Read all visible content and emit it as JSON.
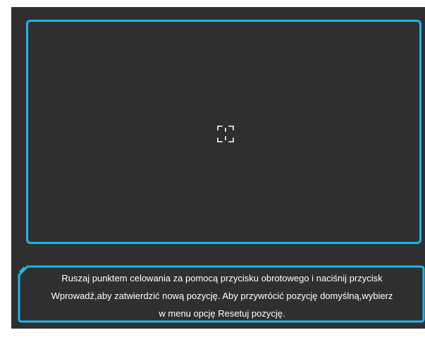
{
  "osd": {
    "crosshair_icon": "aim-point-crosshair",
    "message_lines": [
      "Ruszaj punktem celowania za pomocą przycisku obrotowego i naciśnij przycisk",
      "Wprowadź,aby zatwierdzić nową pozycję. Aby przywrócić pozycję domyślną,wybierz",
      "w menu opcję Resetuj pozycję."
    ]
  },
  "colors": {
    "background": "#2f2f2f",
    "accent": "#1fb6e8",
    "text": "#ffffff"
  }
}
